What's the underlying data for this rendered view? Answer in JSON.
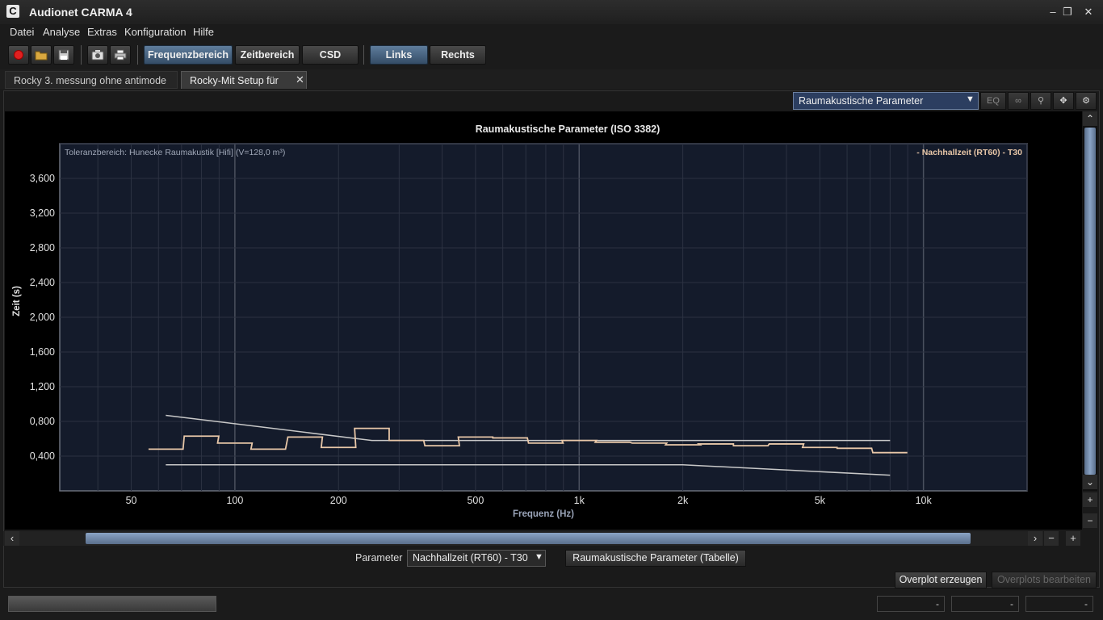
{
  "window": {
    "title": "Audionet CARMA 4",
    "app_icon": "C"
  },
  "menu": {
    "items": [
      "Datei",
      "Analyse",
      "Extras",
      "Konfiguration",
      "Hilfe"
    ]
  },
  "toolbar": {
    "buttons": [
      {
        "name": "record",
        "icon": "record-icon"
      },
      {
        "name": "open",
        "icon": "folder-icon"
      },
      {
        "name": "save",
        "icon": "save-icon"
      },
      {
        "name": "screenshot",
        "icon": "camera-icon"
      },
      {
        "name": "print",
        "icon": "printer-icon"
      }
    ],
    "view_tabs": [
      "Frequenzbereich",
      "Zeitbereich",
      "CSD"
    ],
    "channel_tabs": [
      "Links",
      "Rechts"
    ]
  },
  "doc_tabs": [
    "Rocky 3. messung ohne antimode",
    "Rocky-Mit Setup für Sub"
  ],
  "chart_toolbar": {
    "selected_view": "Raumakustische Parameter",
    "eq_label": "EQ"
  },
  "params": {
    "label": "Parameter",
    "selected": "Nachhallzeit (RT60) - T30",
    "table_button": "Raumakustische Parameter (Tabelle)"
  },
  "overplot": {
    "create": "Overplot erzeugen",
    "edit": "Overplots bearbeiten"
  },
  "status": {
    "fields": [
      "-",
      "-",
      "-"
    ]
  },
  "colors": {
    "accent": "#5f7d9c",
    "curve": "#e8c7a8",
    "tolerance": "#c8c8c8",
    "plot_bg": "#141b2b"
  },
  "chart_data": {
    "type": "line",
    "title": "Raumakustische Parameter (ISO 3382)",
    "annotation": "Toleranzbereich: Hunecke Raumakustik [Hifi] (V=128,0 m³)",
    "legend": "- Nachhallzeit (RT60) - T30",
    "legend_position": "top-right",
    "xlabel": "Frequenz (Hz)",
    "ylabel": "Zeit (s)",
    "x_scale": "log",
    "xlim": [
      31,
      20000
    ],
    "ylim": [
      0,
      4.0
    ],
    "x_ticks": [
      {
        "value": 50,
        "label": "50"
      },
      {
        "value": 100,
        "label": "100"
      },
      {
        "value": 200,
        "label": "200"
      },
      {
        "value": 500,
        "label": "500"
      },
      {
        "value": 1000,
        "label": "1k"
      },
      {
        "value": 2000,
        "label": "2k"
      },
      {
        "value": 5000,
        "label": "5k"
      },
      {
        "value": 10000,
        "label": "10k"
      }
    ],
    "y_ticks": [
      {
        "value": 0.4,
        "label": "0,400"
      },
      {
        "value": 0.8,
        "label": "0,800"
      },
      {
        "value": 1.2,
        "label": "1,200"
      },
      {
        "value": 1.6,
        "label": "1,600"
      },
      {
        "value": 2.0,
        "label": "2,000"
      },
      {
        "value": 2.4,
        "label": "2,400"
      },
      {
        "value": 2.8,
        "label": "2,800"
      },
      {
        "value": 3.2,
        "label": "3,200"
      },
      {
        "value": 3.6,
        "label": "3,600"
      }
    ],
    "grid": true,
    "series": [
      {
        "name": "Nachhallzeit (RT60) - T30",
        "style": "step",
        "bands": [
          {
            "f": 63,
            "v": 0.48
          },
          {
            "f": 80,
            "v": 0.63
          },
          {
            "f": 100,
            "v": 0.55
          },
          {
            "f": 125,
            "v": 0.48
          },
          {
            "f": 160,
            "v": 0.62
          },
          {
            "f": 200,
            "v": 0.5
          },
          {
            "f": 250,
            "v": 0.72
          },
          {
            "f": 315,
            "v": 0.58
          },
          {
            "f": 400,
            "v": 0.52
          },
          {
            "f": 500,
            "v": 0.62
          },
          {
            "f": 630,
            "v": 0.61
          },
          {
            "f": 800,
            "v": 0.55
          },
          {
            "f": 1000,
            "v": 0.58
          },
          {
            "f": 1250,
            "v": 0.56
          },
          {
            "f": 1600,
            "v": 0.55
          },
          {
            "f": 2000,
            "v": 0.53
          },
          {
            "f": 2500,
            "v": 0.54
          },
          {
            "f": 3150,
            "v": 0.52
          },
          {
            "f": 4000,
            "v": 0.54
          },
          {
            "f": 5000,
            "v": 0.5
          },
          {
            "f": 6300,
            "v": 0.49
          },
          {
            "f": 8000,
            "v": 0.44
          }
        ]
      },
      {
        "name": "tolerance-upper",
        "points": [
          [
            63,
            0.87
          ],
          [
            250,
            0.58
          ],
          [
            8000,
            0.58
          ]
        ]
      },
      {
        "name": "tolerance-lower",
        "points": [
          [
            63,
            0.3
          ],
          [
            2000,
            0.3
          ],
          [
            8000,
            0.18
          ]
        ]
      }
    ]
  }
}
